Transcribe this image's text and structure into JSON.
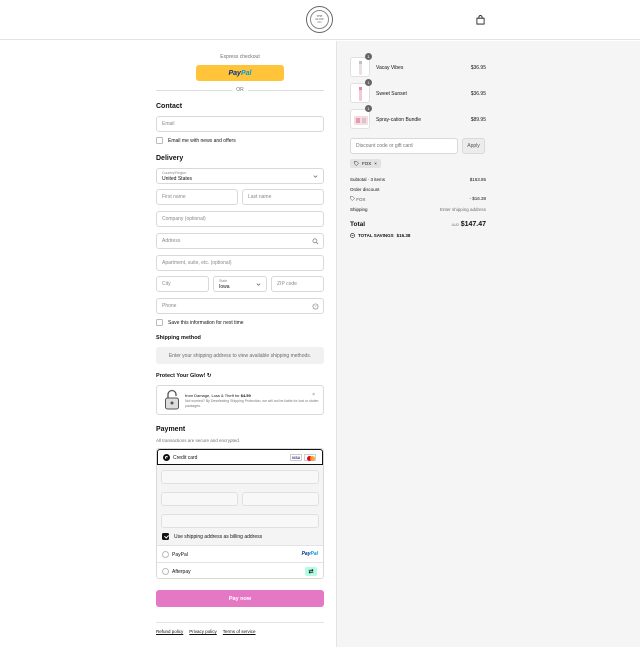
{
  "header": {
    "logo_lines": [
      "THE",
      "GLOW",
      "CO"
    ],
    "bag_icon": "shopping-bag-icon"
  },
  "express": {
    "label": "Express checkout",
    "paypal_pay": "Pay",
    "paypal_pal": "Pal",
    "or": "OR"
  },
  "contact": {
    "title": "Contact",
    "email_placeholder": "Email",
    "newsletter_label": "Email me with news and offers"
  },
  "delivery": {
    "title": "Delivery",
    "country_label": "Country/Region",
    "country_value": "United States",
    "first_name_placeholder": "First name",
    "last_name_placeholder": "Last name",
    "company_placeholder": "Company (optional)",
    "address_placeholder": "Address",
    "apartment_placeholder": "Apartment, suite, etc. (optional)",
    "city_placeholder": "City",
    "state_label": "State",
    "state_value": "Iowa",
    "zip_placeholder": "ZIP code",
    "phone_placeholder": "Phone",
    "save_info_label": "Save this information for next time"
  },
  "shipping": {
    "title": "Shipping method",
    "message": "Enter your shipping address to view available shipping methods."
  },
  "protect": {
    "title": "Protect Your Glow! ↻",
    "line1_prefix": "from Damage, Loss & Theft for ",
    "line1_price": "$4.59",
    "line2": "Not worried? By Deselecting Shipping Protection, we will not be liable for lost or stolen packages.",
    "close": "×"
  },
  "payment": {
    "title": "Payment",
    "subtitle": "All transactions are secure and encrypted.",
    "credit_card_label": "Credit card",
    "visa_label": "VISA",
    "billing_label": "Use shipping address as billing address",
    "paypal_label": "PayPal",
    "paypal_logo_a": "Pay",
    "paypal_logo_b": "Pal",
    "afterpay_label": "Afterpay",
    "afterpay_logo": "⇄"
  },
  "pay_now": "Pay now",
  "footer": {
    "links": [
      "Refund policy",
      "Privacy policy",
      "Terms of service"
    ]
  },
  "cart": {
    "items": [
      {
        "qty": "1",
        "name": "Vacay Vibes",
        "price": "$36.95"
      },
      {
        "qty": "1",
        "name": "Sweet Sunset",
        "price": "$36.95"
      },
      {
        "qty": "1",
        "name": "Spray-cation Bundle",
        "price": "$89.95"
      }
    ],
    "discount_placeholder": "Discount code or gift card",
    "apply_label": "Apply",
    "applied_code": "FOX",
    "remove_code": "×"
  },
  "summary": {
    "subtotal_label": "Subtotal · 3 items",
    "subtotal_value": "$163.85",
    "order_discount_label": "Order discount",
    "discount_code": "FOX",
    "discount_value": "- $16.38",
    "shipping_label": "Shipping",
    "shipping_value": "Enter shipping address",
    "total_label": "Total",
    "currency": "AUD",
    "total_value": "$147.47",
    "savings_label": "TOTAL SAVINGS",
    "savings_value": "$16.38"
  },
  "colors": {
    "accent_pay": "#e578c5",
    "paypal_yellow": "#ffc439",
    "sidebar_bg": "#f5f5f5"
  }
}
